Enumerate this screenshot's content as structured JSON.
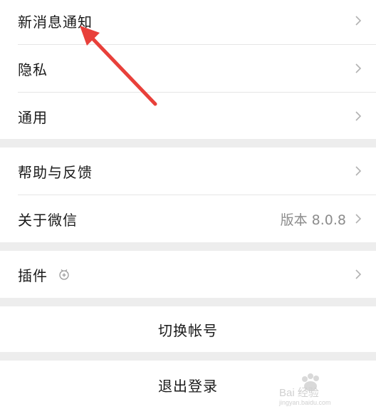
{
  "settings": {
    "group1": {
      "items": [
        {
          "label": "新消息通知"
        },
        {
          "label": "隐私"
        },
        {
          "label": "通用"
        }
      ]
    },
    "group2": {
      "items": [
        {
          "label": "帮助与反馈"
        },
        {
          "label": "关于微信",
          "value": "版本 8.0.8"
        }
      ]
    },
    "group3": {
      "items": [
        {
          "label": "插件",
          "icon": "plugin-icon"
        }
      ]
    },
    "switch_account_label": "切换帐号",
    "logout_label": "退出登录"
  },
  "colors": {
    "background": "#ededed",
    "cell": "#ffffff",
    "annotation_arrow": "#e8403a"
  },
  "watermark": {
    "text": "Bai 经验",
    "subtext": "jingyan.baidu.com"
  }
}
